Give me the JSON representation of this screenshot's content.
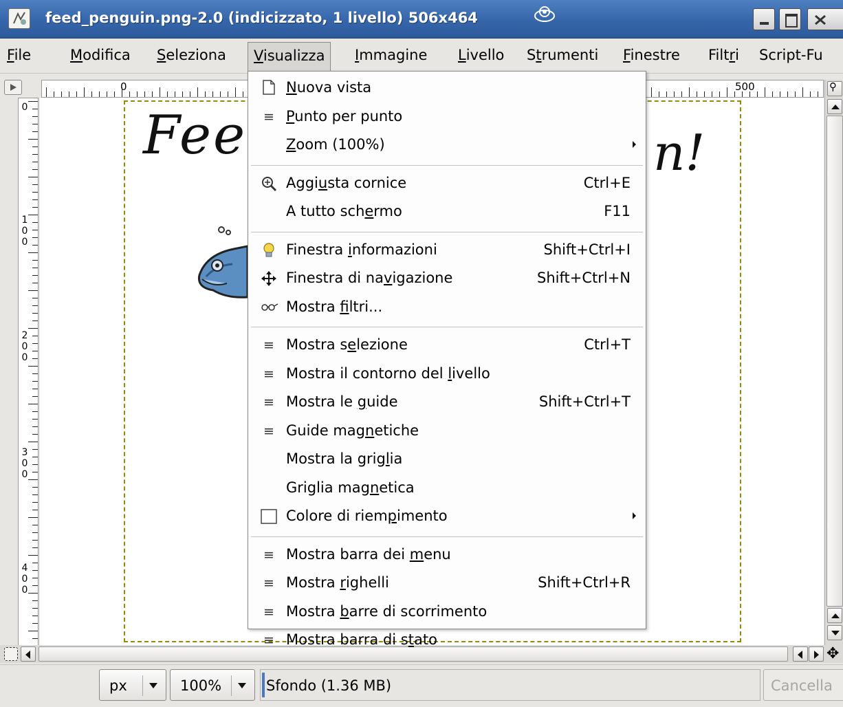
{
  "window": {
    "title": "feed_penguin.png-2.0 (indicizzato, 1 livello) 506x464"
  },
  "menubar": [
    {
      "label": "File",
      "mnemonic": "F",
      "rest": "ile"
    },
    {
      "label": "Modifica",
      "mnemonic": "M",
      "rest": "odifica"
    },
    {
      "label": "Seleziona",
      "mnemonic": "S",
      "rest": "eleziona"
    },
    {
      "label": "Visualizza",
      "mnemonic": "V",
      "rest": "isualizza"
    },
    {
      "label": "Immagine",
      "mnemonic": "I",
      "rest": "mmagine"
    },
    {
      "label": "Livello",
      "mnemonic": "L",
      "rest": "ivello"
    },
    {
      "label": "Strumenti",
      "pre": "S",
      "mnemonic": "t",
      "rest": "rumenti"
    },
    {
      "label": "Finestre",
      "mnemonic": "F",
      "rest": "inestre"
    },
    {
      "label": "Filtri",
      "pre": "Filt",
      "mnemonic": "r",
      "rest": "i"
    },
    {
      "label": "Script-Fu",
      "mnemonic": "",
      "rest": "Script-Fu"
    }
  ],
  "rulers": {
    "horizontal_labels": [
      "0",
      "500"
    ],
    "vertical_labels": [
      [
        "0"
      ],
      [
        "1",
        "0",
        "0"
      ],
      [
        "2",
        "0",
        "0"
      ],
      [
        "3",
        "0",
        "0"
      ],
      [
        "4",
        "0",
        "0"
      ]
    ]
  },
  "canvas": {
    "text_left": "Fee",
    "text_right": "n!"
  },
  "view_menu": {
    "items": [
      {
        "icon": "new-view-icon",
        "glyph": "",
        "pre": "",
        "mn": "N",
        "post": "uova vista",
        "shortcut": ""
      },
      {
        "icon": "check-icon",
        "glyph": "≡",
        "pre": "",
        "mn": "P",
        "post": "unto per punto",
        "shortcut": ""
      },
      {
        "icon": "",
        "glyph": "",
        "pre": "",
        "mn": "Z",
        "post": "oom (100%)",
        "shortcut": "",
        "submenu": true
      },
      {
        "sep": true
      },
      {
        "icon": "zoom-fit-icon",
        "glyph": "🔍",
        "pre": "Aggi",
        "mn": "u",
        "post": "sta cornice",
        "shortcut": "Ctrl+E"
      },
      {
        "icon": "",
        "glyph": "",
        "pre": "A tutto sch",
        "mn": "e",
        "post": "rmo",
        "shortcut": "F11"
      },
      {
        "sep": true
      },
      {
        "icon": "info-bulb-icon",
        "glyph": "💡",
        "pre": "Finestra ",
        "mn": "i",
        "post": "nformazioni",
        "shortcut": "Shift+Ctrl+I"
      },
      {
        "icon": "navigation-icon",
        "glyph": "✥",
        "pre": "Finestra di na",
        "mn": "v",
        "post": "igazione",
        "shortcut": "Shift+Ctrl+N"
      },
      {
        "icon": "glasses-icon",
        "glyph": "👓",
        "pre": "Mostra ",
        "mn": "f",
        "post": "iltri...",
        "shortcut": ""
      },
      {
        "sep": true
      },
      {
        "icon": "check-icon",
        "glyph": "≡",
        "pre": "Mostra s",
        "mn": "e",
        "post": "lezione",
        "shortcut": "Ctrl+T"
      },
      {
        "icon": "check-icon",
        "glyph": "≡",
        "pre": "Mostra il contorno del ",
        "mn": "l",
        "post": "ivello",
        "shortcut": ""
      },
      {
        "icon": "check-icon",
        "glyph": "≡",
        "pre": "Mostra le ",
        "mn": "g",
        "post": "uide",
        "shortcut": "Shift+Ctrl+T"
      },
      {
        "icon": "check-icon",
        "glyph": "≡",
        "pre": "Guide mag",
        "mn": "n",
        "post": "etiche",
        "shortcut": ""
      },
      {
        "icon": "",
        "glyph": "",
        "pre": "Mostra la grig",
        "mn": "l",
        "post": "ia",
        "shortcut": ""
      },
      {
        "icon": "",
        "glyph": "",
        "pre": "Griglia mag",
        "mn": "n",
        "post": "etica",
        "shortcut": ""
      },
      {
        "icon": "fill-color-swatch-icon",
        "glyph": "",
        "pre": "Colore di riem",
        "mn": "p",
        "post": "imento",
        "shortcut": "",
        "submenu": true
      },
      {
        "sep": true
      },
      {
        "icon": "check-icon",
        "glyph": "≡",
        "pre": "Mostra barra dei ",
        "mn": "m",
        "post": "enu",
        "shortcut": ""
      },
      {
        "icon": "check-icon",
        "glyph": "≡",
        "pre": "Mostra ",
        "mn": "r",
        "post": "ighelli",
        "shortcut": "Shift+Ctrl+R"
      },
      {
        "icon": "check-icon",
        "glyph": "≡",
        "pre": "Mostra ",
        "mn": "b",
        "post": "arre di scorrimento",
        "shortcut": ""
      },
      {
        "icon": "check-icon",
        "glyph": "≡",
        "pre": "Mostra barra di s",
        "mn": "t",
        "post": "ato",
        "shortcut": ""
      }
    ]
  },
  "statusbar": {
    "unit": "px",
    "zoom": "100%",
    "status": "Sfondo (1.36 MB)",
    "cancel": "Cancella"
  },
  "colors": {
    "title_bar": "#3666aa",
    "selection_dash": "#d6c200",
    "progress": "#4a78c8"
  }
}
